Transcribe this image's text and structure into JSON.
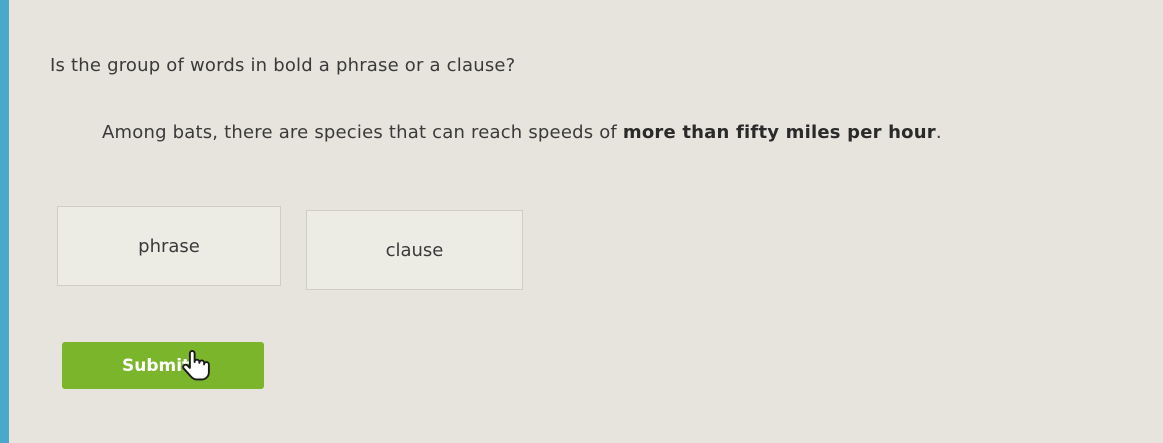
{
  "question": {
    "prompt": "Is the group of words in bold a phrase or a clause?"
  },
  "sentence": {
    "normal": "Among bats, there are species that can reach speeds of ",
    "bold": "more than fifty miles per hour",
    "end": "."
  },
  "choices": [
    {
      "label": "phrase"
    },
    {
      "label": "clause"
    }
  ],
  "submit": {
    "label": "Submit"
  },
  "colors": {
    "background": "#e6e4dc",
    "accent_strip": "#4aa9c9",
    "submit_green": "#7ab52b"
  },
  "icons": {
    "cursor": "pointer-hand-cursor-icon"
  }
}
